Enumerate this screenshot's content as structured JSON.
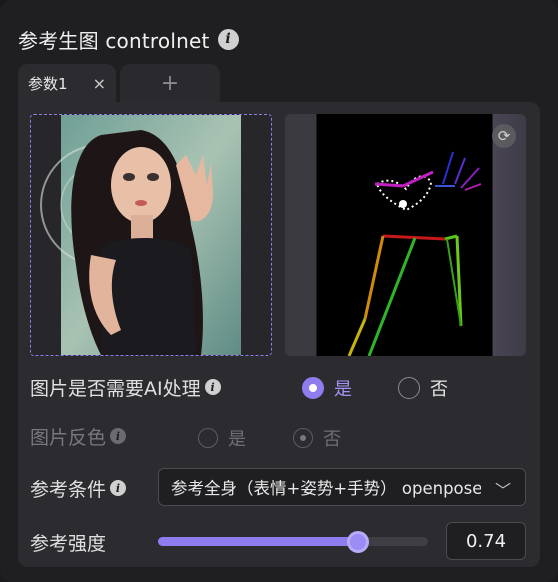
{
  "header": {
    "title": "参考生图 controlnet",
    "info_icon": "info-icon"
  },
  "tabs": [
    {
      "label": "参数1",
      "close_icon": "×",
      "active": true
    },
    {
      "label": "+",
      "active": false
    }
  ],
  "images": {
    "source": {
      "alt": "reference photo"
    },
    "pose": {
      "refresh_icon": "⟳"
    }
  },
  "ai_process": {
    "label": "图片是否需要AI处理",
    "options": [
      {
        "label": "是",
        "checked": true
      },
      {
        "label": "否",
        "checked": false
      }
    ]
  },
  "invert": {
    "label": "图片反色",
    "disabled": true,
    "options": [
      {
        "label": "是",
        "checked": false
      },
      {
        "label": "否",
        "checked": true
      }
    ]
  },
  "condition": {
    "label": "参考条件",
    "selected": "参考全身（表情+姿势+手势） openpose"
  },
  "strength": {
    "label": "参考强度",
    "value": "0.74",
    "fraction": 0.74,
    "min": 0,
    "max": 1
  },
  "colors": {
    "accent": "#8f7df0",
    "panel_bg": "#1f1f22",
    "card_bg": "#2c2c30"
  }
}
